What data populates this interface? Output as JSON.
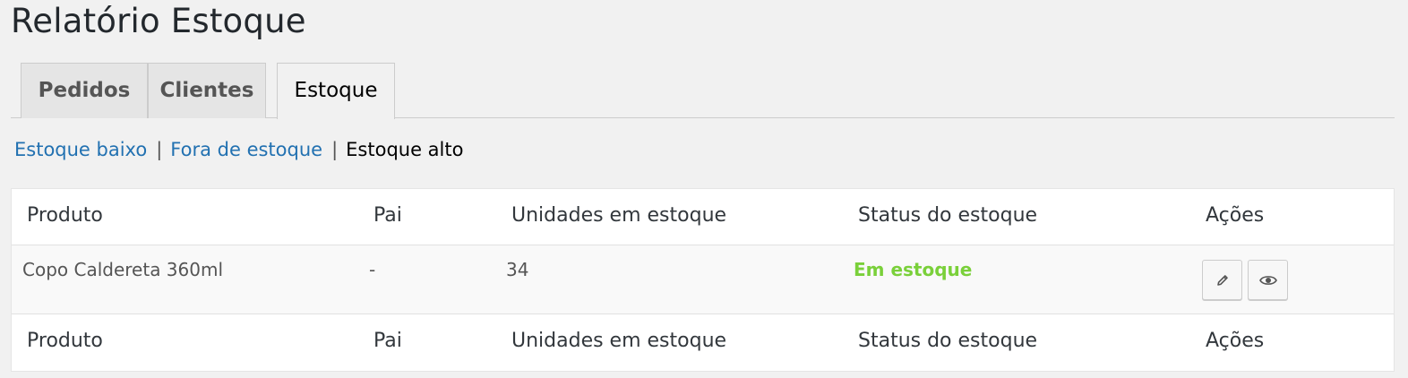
{
  "page": {
    "title": "Relatório Estoque"
  },
  "tabs": [
    {
      "label": "Pedidos",
      "active": false
    },
    {
      "label": "Clientes",
      "active": false
    },
    {
      "label": "Estoque",
      "active": true
    }
  ],
  "filters": {
    "items": [
      {
        "label": "Estoque baixo",
        "current": false
      },
      {
        "label": "Fora de estoque",
        "current": false
      },
      {
        "label": "Estoque alto",
        "current": true
      }
    ],
    "separator": "|"
  },
  "table": {
    "columns": [
      "Produto",
      "Pai",
      "Unidades em estoque",
      "Status do estoque",
      "Ações"
    ],
    "rows": [
      {
        "product": "Copo Caldereta 360ml",
        "parent": "-",
        "units": "34",
        "status": "Em estoque",
        "actions": [
          "pencil-icon",
          "eye-icon"
        ]
      }
    ]
  },
  "colors": {
    "link": "#2271b1",
    "status_in_stock": "#7ad03a",
    "background": "#f1f1f1"
  }
}
